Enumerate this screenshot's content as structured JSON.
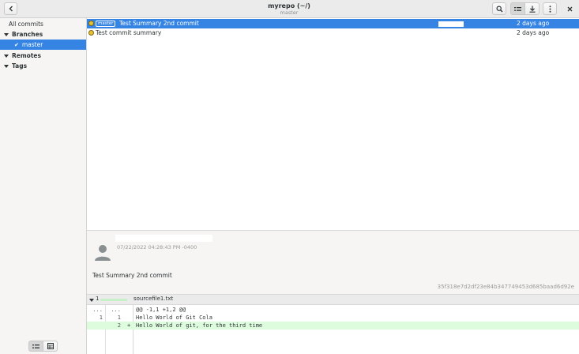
{
  "header": {
    "title": "myrepo (~/)",
    "subtitle": "master"
  },
  "sidebar": {
    "all_commits": "All commits",
    "branches": "Branches",
    "branch_items": [
      "master"
    ],
    "remotes": "Remotes",
    "tags": "Tags"
  },
  "commits": [
    {
      "badge": "master",
      "message": "Test Summary 2nd commit",
      "time": "2 days ago",
      "selected": true
    },
    {
      "badge": "",
      "message": "Test commit summary",
      "time": "2 days ago",
      "selected": false
    }
  ],
  "details": {
    "date": "07/22/2022 04:28:43 PM -0400",
    "summary": "Test Summary 2nd commit",
    "hash": "35f318e7d2df23e84b347749453d685baad6d92e"
  },
  "diff": {
    "file_count": "1",
    "file_name": "sourcefile1.txt",
    "lines": [
      {
        "old": "...",
        "new": "...",
        "mark": "",
        "text": "@@ -1,1 +1,2 @@",
        "type": "hunk"
      },
      {
        "old": "1",
        "new": "1",
        "mark": "",
        "text": "Hello World of Git Cola",
        "type": "context"
      },
      {
        "old": "",
        "new": "2",
        "mark": "+",
        "text": "Hello World of git, for the third time",
        "type": "added"
      }
    ]
  },
  "colors": {
    "accent": "#3584e4",
    "node": "#e9c232",
    "added_bg": "#ddfbdd"
  }
}
